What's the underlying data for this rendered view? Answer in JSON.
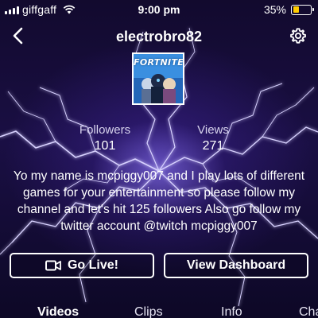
{
  "status_bar": {
    "carrier": "giffgaff",
    "time": "9:00 pm",
    "battery_percent_text": "35%",
    "battery_level": 0.35
  },
  "nav": {
    "title": "electrobro82"
  },
  "avatar": {
    "logo_text": "FORTNITE"
  },
  "stats": {
    "followers_label": "Followers",
    "followers_value": "101",
    "views_label": "Views",
    "views_value": "271"
  },
  "bio": {
    "text": "Yo my name is mcpiggy007 and I play lots of different games for your entertainment so please follow my channel and let's hit 125 followers Also go follow my twitter account @twitch mcpiggy007"
  },
  "buttons": {
    "go_live_label": "Go Live!",
    "view_dashboard_label": "View Dashboard"
  },
  "tabs": [
    {
      "label": "Videos"
    },
    {
      "label": "Clips"
    },
    {
      "label": "Info"
    },
    {
      "label": "Cha"
    }
  ],
  "colors": {
    "battery": "#ffcc00",
    "lightning": "#c9c4ff",
    "background": "#1a0f44"
  },
  "icons": {
    "back": "chevron-left-icon",
    "settings": "gear-icon",
    "camera": "camera-icon",
    "wifi": "wifi-icon"
  }
}
